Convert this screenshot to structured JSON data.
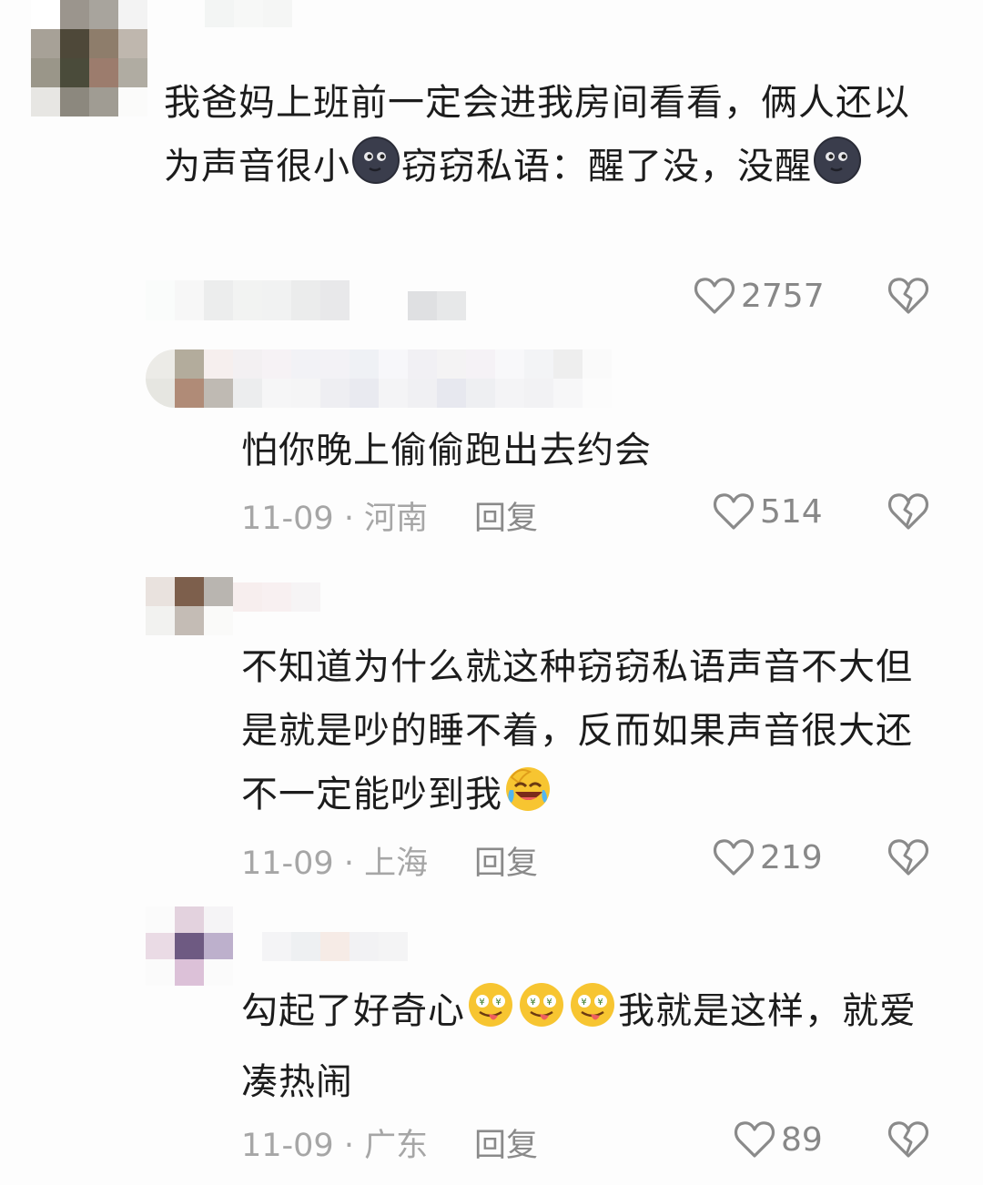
{
  "comments": [
    {
      "text_parts": [
        "我爸妈上班前一定会进我房间看看，俩人还以为声音很小",
        "窃窃私语：醒了没，没醒",
        ""
      ],
      "emojis": [
        "new-moon-face",
        "new-moon-face"
      ],
      "likes": "2757"
    },
    {
      "text": "怕你晚上偷偷跑出去约会",
      "date": "11-09",
      "sep": " · ",
      "location": "河南",
      "reply_label": "回复",
      "likes": "514"
    },
    {
      "text_parts": [
        "不知道为什么就这种窃窃私语声音不大但是就是吵的睡不着，反而如果声音很大还不一定能吵到我",
        ""
      ],
      "emojis": [
        "rolling-laughing-face"
      ],
      "date": "11-09",
      "sep": " · ",
      "location": "上海",
      "reply_label": "回复",
      "likes": "219"
    },
    {
      "text_parts": [
        "勾起了好奇心",
        "我就是这样，就爱凑热闹"
      ],
      "emojis": [
        "money-eyes-tongue-face",
        "money-eyes-tongue-face",
        "money-eyes-tongue-face"
      ],
      "date": "11-09",
      "sep": " · ",
      "location": "广东",
      "reply_label": "回复",
      "likes": "89"
    }
  ],
  "colors": {
    "text": "#1c1c1c",
    "meta": "#a6a6a6",
    "icon": "#8a8a8a",
    "background": "#fdfdfd"
  }
}
